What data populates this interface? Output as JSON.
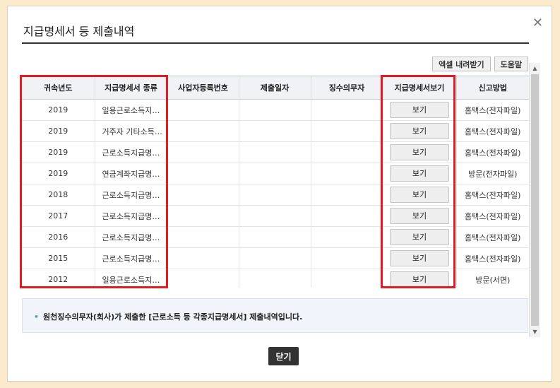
{
  "dialog": {
    "title": "지급명세서 등 제출내역",
    "close_icon": "✕"
  },
  "toolbar": {
    "excel_label": "엑셀 내려받기",
    "help_label": "도움말"
  },
  "table": {
    "headers": [
      "귀속년도",
      "지급명세서 종류",
      "사업자등록번호",
      "제출일자",
      "징수의무자",
      "지급명세서보기",
      "신고방법"
    ],
    "view_label": "보기",
    "rows": [
      {
        "year": "2019",
        "kind": "일용근로소득지급명세서",
        "method": "홈택스(전자파일)"
      },
      {
        "year": "2019",
        "kind": "거주자 기타소득지급명세서",
        "method": "홈택스(전자파일)"
      },
      {
        "year": "2019",
        "kind": "근로소득지급명세서",
        "method": "홈택스(전자파일)"
      },
      {
        "year": "2019",
        "kind": "연금계좌지급명세서",
        "method": "방문(전자파일)"
      },
      {
        "year": "2018",
        "kind": "근로소득지급명세서",
        "method": "홈택스(전자파일)"
      },
      {
        "year": "2017",
        "kind": "근로소득지급명세서",
        "method": "홈택스(전자파일)"
      },
      {
        "year": "2016",
        "kind": "근로소득지급명세서",
        "method": "홈택스(전자파일)"
      },
      {
        "year": "2015",
        "kind": "근로소득지급명세서",
        "method": "홈택스(전자파일)"
      },
      {
        "year": "2012",
        "kind": "일용근로소득지급명세서",
        "method": "방문(서면)"
      }
    ]
  },
  "notice": {
    "text": "원천징수의무자(회사)가 제출한 [근로소득 등 각종지급명세서] 제출내역입니다."
  },
  "footer": {
    "close_label": "닫기"
  },
  "colors": {
    "highlight": "#e31b23",
    "background": "#fbe9cc",
    "header_bg": "#f0f2f6"
  }
}
